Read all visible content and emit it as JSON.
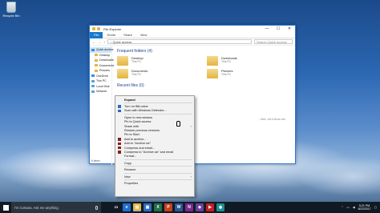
{
  "desktop": {
    "recycle_bin_label": "Recycle Bin"
  },
  "explorer": {
    "title": "File Explorer",
    "controls": {
      "minimize": "—",
      "maximize": "☐",
      "close": "✕"
    },
    "ribbon_tabs": [
      "File",
      "Home",
      "Share",
      "View"
    ],
    "address": "› Quick access",
    "search_placeholder": "Search Quick access",
    "nav": [
      {
        "label": "Quick access",
        "icon": "star-icon",
        "selected": true
      },
      {
        "label": "Desktop",
        "icon": "folder-icon",
        "sub": true
      },
      {
        "label": "Downloads",
        "icon": "folder-icon",
        "sub": true
      },
      {
        "label": "Documents",
        "icon": "folder-icon",
        "sub": true
      },
      {
        "label": "Pictures",
        "icon": "folder-icon",
        "sub": true
      },
      {
        "label": "OneDrive",
        "icon": "cloud-icon"
      },
      {
        "label": "This PC",
        "icon": "pc-icon"
      },
      {
        "label": "Local Disk",
        "icon": "disk-icon"
      },
      {
        "label": "Network",
        "icon": "network-icon"
      }
    ],
    "frequent_header": "Frequent folders (4)",
    "folders": [
      {
        "name": "Desktop",
        "sub": "This PC"
      },
      {
        "name": "Downloads",
        "sub": "This PC"
      },
      {
        "name": "Documents",
        "sub": "This PC"
      },
      {
        "name": "Pictures",
        "sub": "This PC"
      }
    ],
    "recent_header": "Recent files (0)",
    "recent_note": "...files, we'll show the",
    "status": "6 items"
  },
  "context_menu": {
    "items": [
      {
        "label": "Expand",
        "bold": true
      },
      {
        "sep": true
      },
      {
        "label": "Turn on BitLocker",
        "icon": "shield"
      },
      {
        "label": "Scan with Windows Defender...",
        "icon": "defender"
      },
      {
        "sep": true
      },
      {
        "label": "Open in new window"
      },
      {
        "label": "Pin to Quick access"
      },
      {
        "label": "Share with",
        "arrow": true
      },
      {
        "label": "Restore previous versions"
      },
      {
        "label": "Pin to Start"
      },
      {
        "label": "Add to archive...",
        "icon": "winrar"
      },
      {
        "label": "Add to \"Archive.rar\"",
        "icon": "winrar"
      },
      {
        "label": "Compress and email...",
        "icon": "winrar"
      },
      {
        "label": "Compress to \"Archive.rar\" and email",
        "icon": "winrar"
      },
      {
        "label": "Format..."
      },
      {
        "sep": true
      },
      {
        "label": "Copy"
      },
      {
        "sep": true
      },
      {
        "label": "Rename"
      },
      {
        "sep": true
      },
      {
        "label": "New",
        "arrow": true
      },
      {
        "sep": true
      },
      {
        "label": "Properties"
      }
    ]
  },
  "taskbar": {
    "search_placeholder": "I'm Cortana. Ask me anything.",
    "apps": [
      {
        "name": "task-view",
        "glyph": "▭",
        "color": "#101a24"
      },
      {
        "name": "edge",
        "glyph": "e",
        "color": "#1e6fd0"
      },
      {
        "name": "file-explorer",
        "glyph": "▤",
        "color": "#e5b445"
      },
      {
        "name": "store",
        "glyph": "▣",
        "color": "#2d6bc4"
      },
      {
        "name": "excel",
        "glyph": "X",
        "color": "#1f7145"
      },
      {
        "name": "powerpoint",
        "glyph": "P",
        "color": "#c4411f"
      },
      {
        "name": "word",
        "glyph": "W",
        "color": "#2b5797"
      },
      {
        "name": "onenote",
        "glyph": "N",
        "color": "#7a2b8c"
      },
      {
        "name": "app-purple",
        "glyph": "◆",
        "color": "#6b3fa0"
      },
      {
        "name": "app-red",
        "glyph": "▶",
        "color": "#c4201f"
      },
      {
        "name": "app-teal",
        "glyph": "◉",
        "color": "#1a8f8f"
      }
    ],
    "time": "5:21 PM",
    "date": "8/22/2017"
  }
}
